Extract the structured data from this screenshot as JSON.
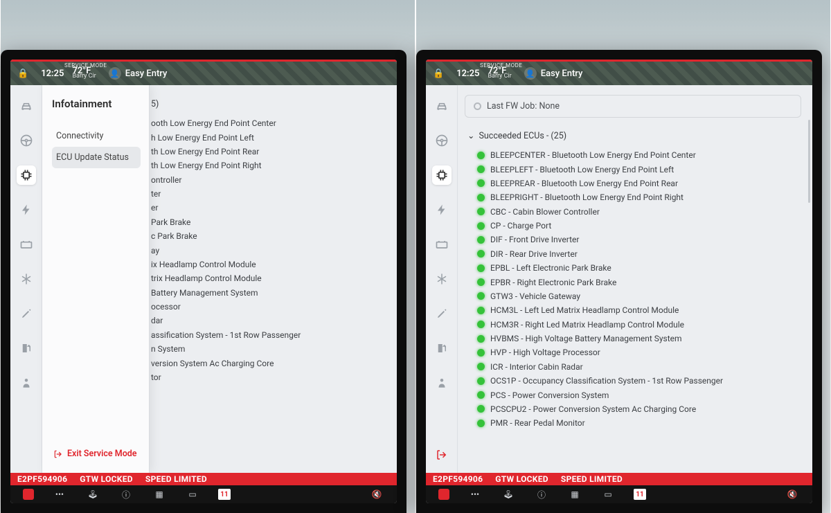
{
  "status": {
    "service_mode": "SERVICE MODE",
    "time": "12:25",
    "temp": "72°F",
    "location": "Barry Cir",
    "profile": "Easy Entry"
  },
  "section_title": "Infotainment",
  "submenu": {
    "items": [
      {
        "label": "Connectivity"
      },
      {
        "label": "ECU Update Status"
      }
    ],
    "exit": "Exit Service Mode"
  },
  "fw_job": "Last FW Job: None",
  "group_header": "Succeeded ECUs - (25)",
  "ecus": [
    "BLEEPCENTER - Bluetooth Low Energy End Point Center",
    "BLEEPLEFT - Bluetooth Low Energy End Point Left",
    "BLEEPREAR - Bluetooth Low Energy End Point Rear",
    "BLEEPRIGHT - Bluetooth Low Energy End Point Right",
    "CBC - Cabin Blower Controller",
    "CP - Charge Port",
    "DIF - Front Drive Inverter",
    "DIR - Rear Drive Inverter",
    "EPBL - Left Electronic Park Brake",
    "EPBR - Right Electronic Park Brake",
    "GTW3 - Vehicle Gateway",
    "HCM3L - Left Led Matrix Headlamp Control Module",
    "HCM3R - Right Led Matrix Headlamp Control Module",
    "HVBMS - High Voltage Battery Management System",
    "HVP - High Voltage Processor",
    "ICR - Interior Cabin Radar",
    "OCS1P - Occupancy Classification System - 1st Row Passenger",
    "PCS - Power Conversion System",
    "PCSCPU2 - Power Conversion System Ac Charging Core",
    "PMR - Rear Pedal Monitor"
  ],
  "left_clipped": [
    "5)",
    "ooth Low Energy End Point Center",
    "h Low Energy End Point Left",
    "th Low Energy End Point Rear",
    "th Low Energy End Point Right",
    "ontroller",
    "ter",
    "er",
    "Park Brake",
    "c Park Brake",
    "ay",
    "ix Headlamp Control Module",
    "trix Headlamp Control Module",
    "Battery Management System",
    "ocessor",
    "dar",
    "assification System - 1st Row Passenger",
    "n System",
    "version System Ac Charging Core",
    "tor"
  ],
  "banner": {
    "vin": "E2PF594906",
    "gtw": "GTW LOCKED",
    "speed": "SPEED LIMITED"
  },
  "dock": {
    "calendar_day": "11"
  },
  "rail_icons": [
    "car",
    "wheel",
    "chip",
    "bolt",
    "battery",
    "snow",
    "pencil",
    "fuel",
    "seat",
    "exit"
  ]
}
